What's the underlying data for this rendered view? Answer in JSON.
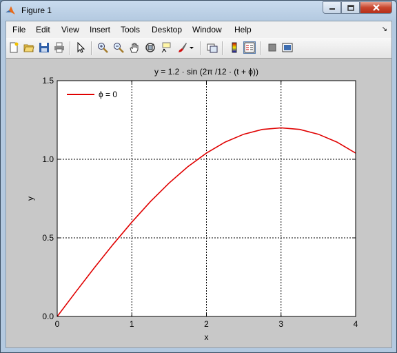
{
  "window": {
    "title": "Figure 1"
  },
  "menu": [
    "File",
    "Edit",
    "View",
    "Insert",
    "Tools",
    "Desktop",
    "Window",
    "Help"
  ],
  "toolbar_icons": [
    "new-figure-icon",
    "open-file-icon",
    "save-icon",
    "print-icon",
    "pointer-icon",
    "zoom-in-icon",
    "zoom-out-icon",
    "pan-hand-icon",
    "rotate-3d-icon",
    "data-cursor-icon",
    "brush-icon",
    "brush-dropdown-icon",
    "link-plot-icon",
    "colorbar-icon",
    "legend-icon",
    "hide-plot-tools-icon",
    "show-plot-tools-icon"
  ],
  "colors": {
    "line": "#e00000",
    "axes_bg": "#ffffff",
    "figure_bg": "#c8c8c8"
  },
  "chart_data": {
    "type": "line",
    "title": "y = 1.2 · sin (2π /12 · (t + ϕ))",
    "xlabel": "x",
    "ylabel": "y",
    "xlim": [
      0,
      4
    ],
    "ylim": [
      0,
      1.5
    ],
    "xticks": [
      "0",
      "1",
      "2",
      "3",
      "4"
    ],
    "yticks": [
      "0.0",
      "0.5",
      "1.0",
      "1.5"
    ],
    "grid": true,
    "legend_placement": "top-left",
    "series": [
      {
        "name": "ϕ = 0",
        "x": [
          0,
          0.25,
          0.5,
          0.75,
          1,
          1.25,
          1.5,
          1.75,
          2,
          2.25,
          2.5,
          2.75,
          3,
          3.25,
          3.5,
          3.75,
          4
        ],
        "y": [
          0,
          0.157,
          0.311,
          0.459,
          0.6,
          0.731,
          0.849,
          0.952,
          1.039,
          1.109,
          1.159,
          1.19,
          1.2,
          1.19,
          1.159,
          1.109,
          1.039
        ]
      }
    ]
  }
}
